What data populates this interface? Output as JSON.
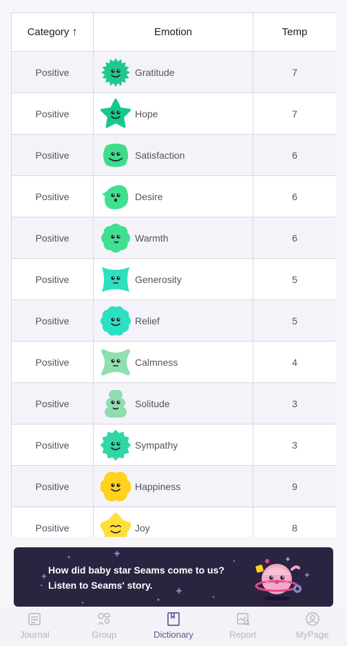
{
  "table": {
    "headers": {
      "category": "Category",
      "emotion": "Emotion",
      "temp": "Temp"
    },
    "rows": [
      {
        "category": "Positive",
        "emotion": "Gratitude",
        "temp": "7",
        "icon": "gratitude-emoji-icon",
        "color": "#1fc98c"
      },
      {
        "category": "Positive",
        "emotion": "Hope",
        "temp": "7",
        "icon": "hope-emoji-icon",
        "color": "#16c98a"
      },
      {
        "category": "Positive",
        "emotion": "Satisfaction",
        "temp": "6",
        "icon": "satisfaction-emoji-icon",
        "color": "#3fdc8c"
      },
      {
        "category": "Positive",
        "emotion": "Desire",
        "temp": "6",
        "icon": "desire-emoji-icon",
        "color": "#3fe08f"
      },
      {
        "category": "Positive",
        "emotion": "Warmth",
        "temp": "6",
        "icon": "warmth-emoji-icon",
        "color": "#3fe08f"
      },
      {
        "category": "Positive",
        "emotion": "Generosity",
        "temp": "5",
        "icon": "generosity-emoji-icon",
        "color": "#2ee0bf"
      },
      {
        "category": "Positive",
        "emotion": "Relief",
        "temp": "5",
        "icon": "relief-emoji-icon",
        "color": "#2ee0c2"
      },
      {
        "category": "Positive",
        "emotion": "Calmness",
        "temp": "4",
        "icon": "calmness-emoji-icon",
        "color": "#8fe0b0"
      },
      {
        "category": "Positive",
        "emotion": "Solitude",
        "temp": "3",
        "icon": "solitude-emoji-icon",
        "color": "#8fdcb0"
      },
      {
        "category": "Positive",
        "emotion": "Sympathy",
        "temp": "3",
        "icon": "sympathy-emoji-icon",
        "color": "#2fd7a6"
      },
      {
        "category": "Positive",
        "emotion": "Happiness",
        "temp": "9",
        "icon": "happiness-emoji-icon",
        "color": "#ffd21e"
      },
      {
        "category": "Positive",
        "emotion": "Joy",
        "temp": "8",
        "icon": "joy-emoji-icon",
        "color": "#ffe03a"
      }
    ]
  },
  "banner": {
    "line1": "How did baby star Seams come to us?",
    "line2": "Listen to Seams' story."
  },
  "nav": {
    "items": [
      {
        "label": "Journal",
        "icon": "journal-icon"
      },
      {
        "label": "Group",
        "icon": "group-icon"
      },
      {
        "label": "Dictionary",
        "icon": "dictionary-icon",
        "active": true
      },
      {
        "label": "Report",
        "icon": "report-icon"
      },
      {
        "label": "MyPage",
        "icon": "mypage-icon"
      }
    ]
  }
}
